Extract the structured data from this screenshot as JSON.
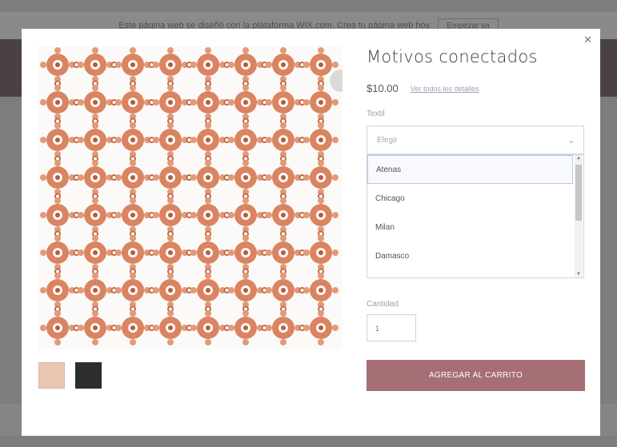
{
  "banner": {
    "message": "Este página web se diseñó con la plataforma WIX.com. Crea tu página web hoy.",
    "button_label": "Empezar ya"
  },
  "modal": {
    "close_icon": "close-icon",
    "product": {
      "title": "Motivos conectados",
      "price": "$10.00",
      "details_link": "Ver todos los detalles"
    },
    "style_field": {
      "label": "Textil",
      "placeholder": "Elegir",
      "options": [
        "Atenas",
        "Chicago",
        "Milan",
        "Damasco"
      ]
    },
    "quantity_field": {
      "label": "Cantidad",
      "value": "1"
    },
    "add_to_cart_label": "AGREGAR AL CARRITO",
    "colors": {
      "pattern": "#d77a55",
      "button": "#a66e75"
    }
  }
}
